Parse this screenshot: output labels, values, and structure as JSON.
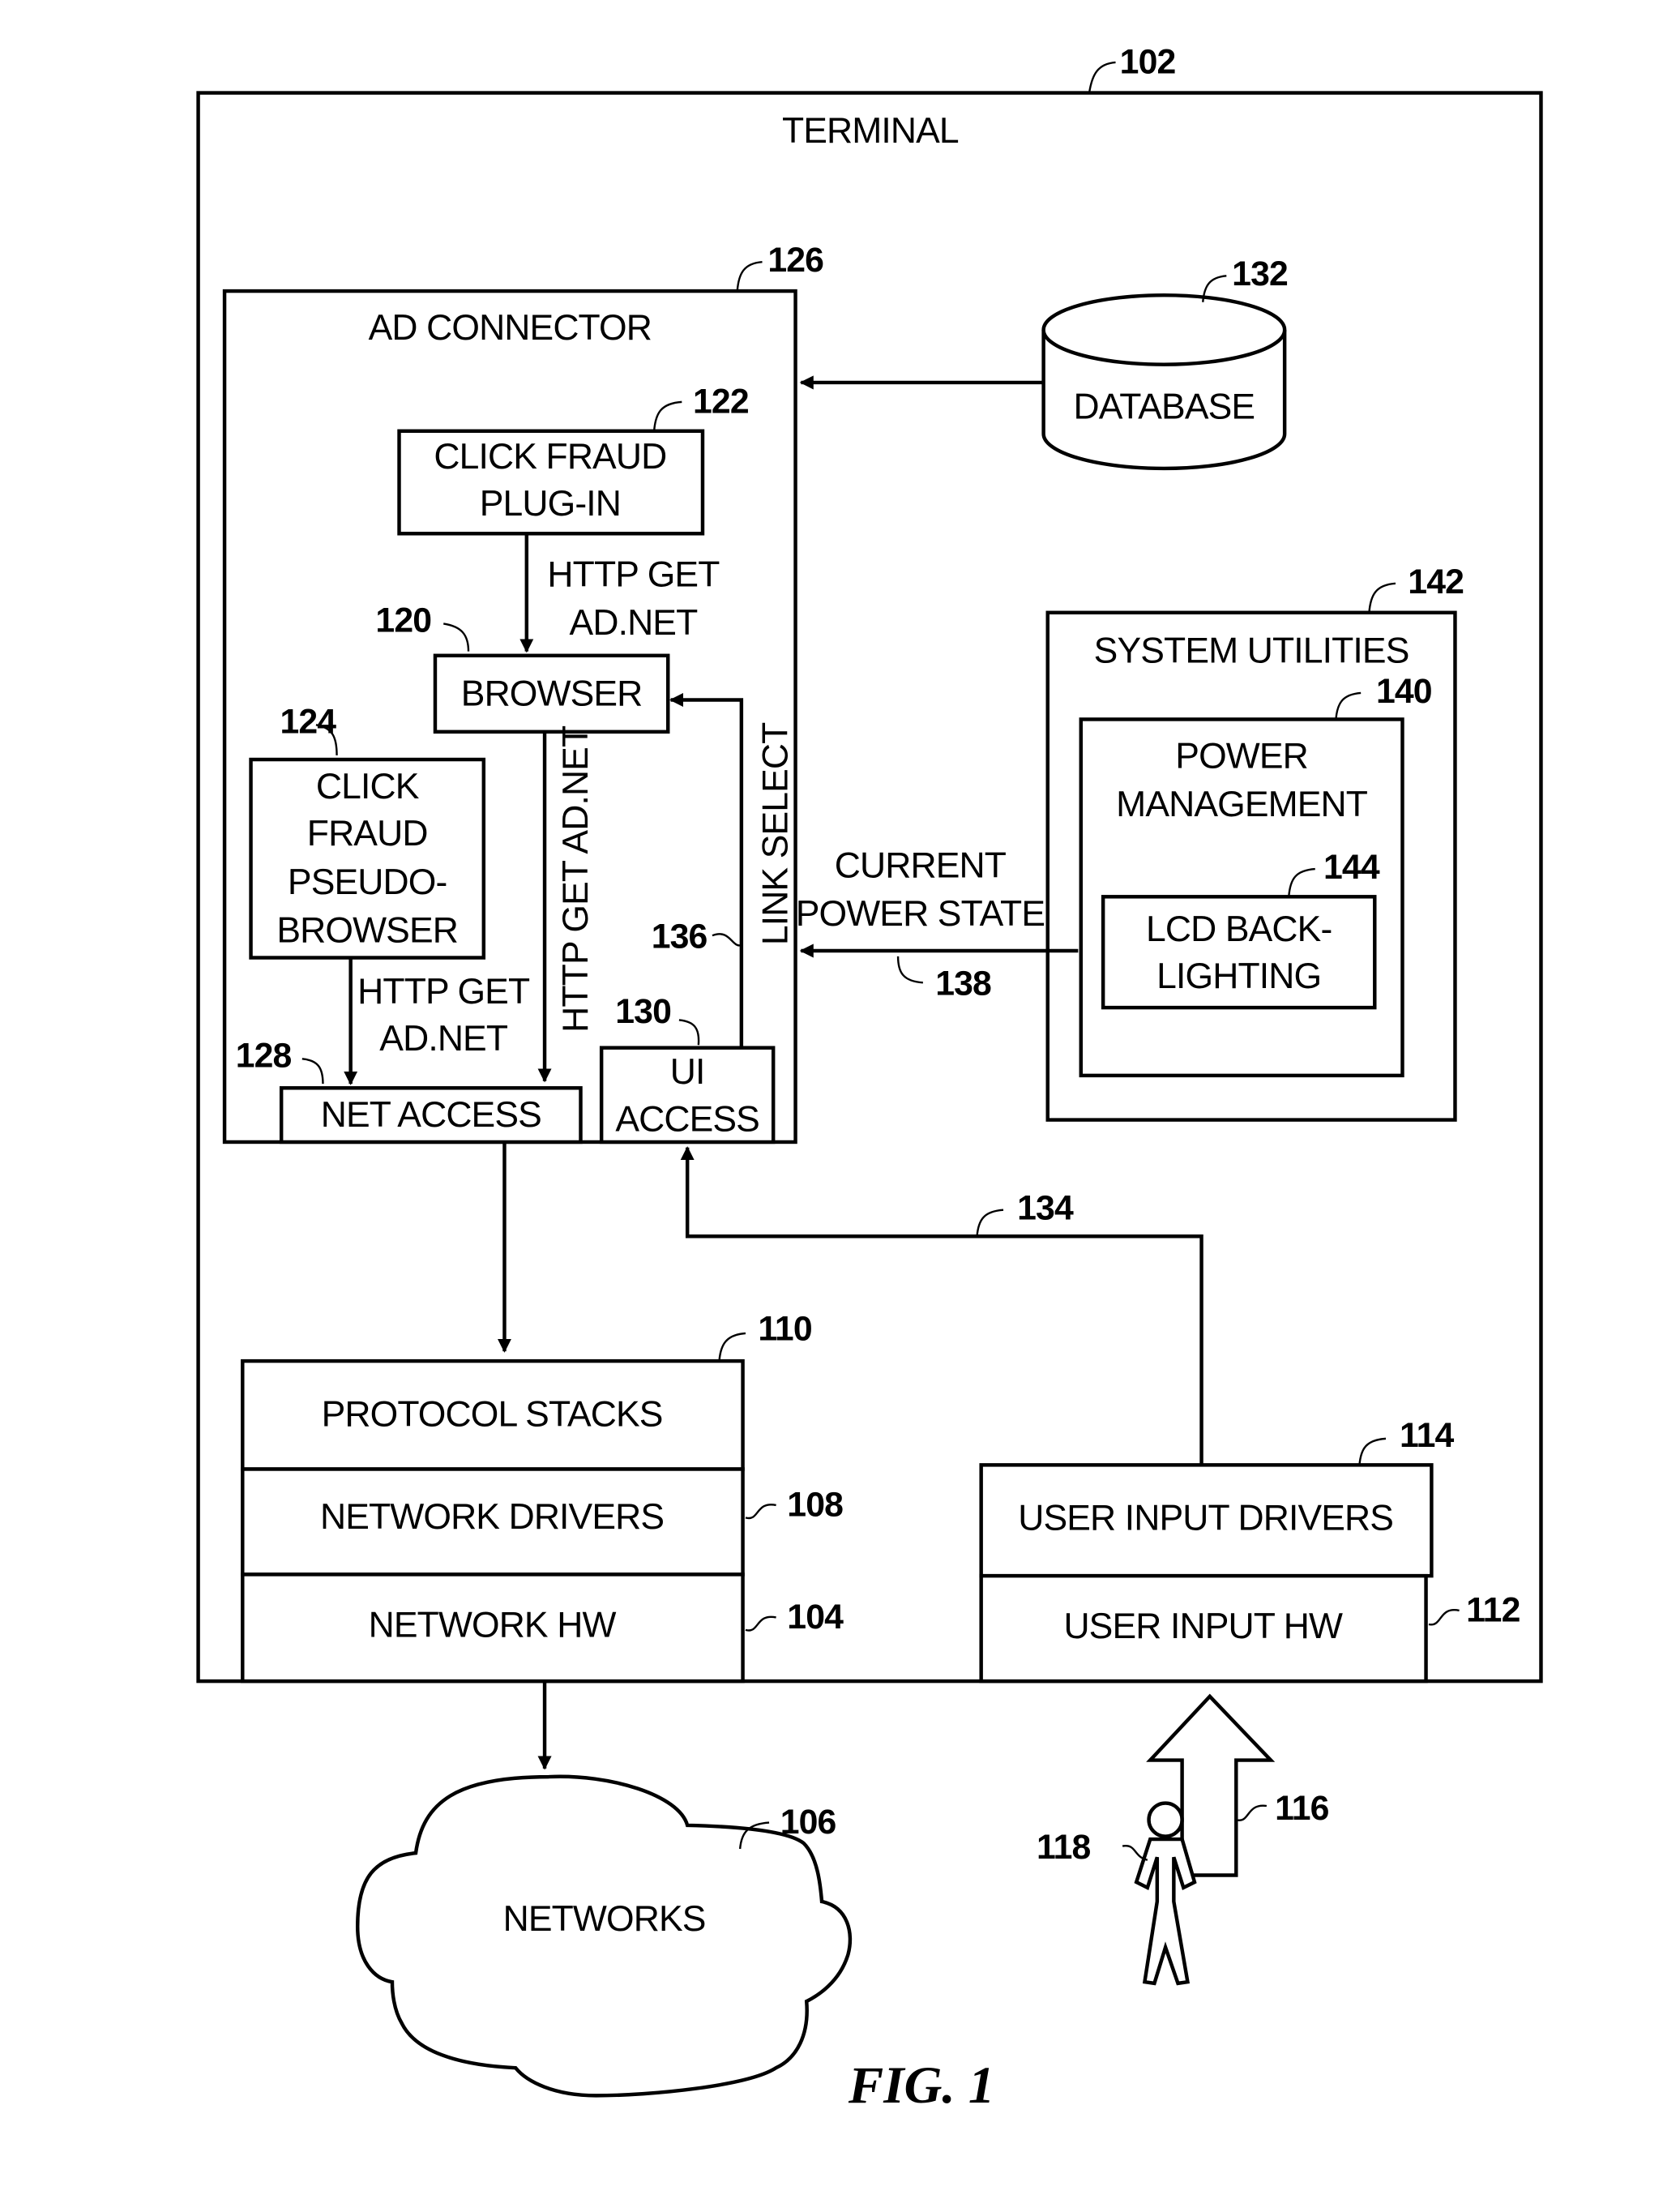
{
  "figure_label": "FIG. 1",
  "terminal": {
    "label": "TERMINAL",
    "ref": "102"
  },
  "ad_connector": {
    "label": "AD CONNECTOR",
    "ref": "126"
  },
  "click_fraud_plugin": {
    "lines": [
      "CLICK FRAUD",
      "PLUG-IN"
    ],
    "ref": "122"
  },
  "browser": {
    "label": "BROWSER",
    "ref": "120"
  },
  "pseudo_browser": {
    "lines": [
      "CLICK",
      "FRAUD",
      "PSEUDO-",
      "BROWSER"
    ],
    "ref": "124"
  },
  "net_access": {
    "label": "NET ACCESS",
    "ref": "128"
  },
  "ui_access": {
    "lines": [
      "UI",
      "ACCESS"
    ],
    "ref": "130"
  },
  "database": {
    "label": "DATABASE",
    "ref": "132"
  },
  "system_utilities": {
    "label": "SYSTEM UTILITIES",
    "ref": "142"
  },
  "power_management": {
    "lines": [
      "POWER",
      "MANAGEMENT"
    ],
    "ref": "140"
  },
  "lcd_backlighting": {
    "lines": [
      "LCD BACK-",
      "LIGHTING"
    ],
    "ref": "144"
  },
  "network_stack": {
    "protocol_stacks": {
      "label": "PROTOCOL STACKS",
      "ref": "110"
    },
    "network_drivers": {
      "label": "NETWORK  DRIVERS",
      "ref": "108"
    },
    "network_hw": {
      "label": "NETWORK  HW",
      "ref": "104"
    }
  },
  "user_input": {
    "drivers": {
      "label": "USER INPUT DRIVERS",
      "ref": "114"
    },
    "hw": {
      "label": "USER INPUT HW",
      "ref": "112"
    }
  },
  "networks": {
    "label": "NETWORKS",
    "ref": "106"
  },
  "user": {
    "ref": "118"
  },
  "user_input_arrow": {
    "ref": "116"
  },
  "arrows": {
    "plugin_to_browser": [
      "HTTP GET",
      "AD.NET"
    ],
    "pseudo_to_net": [
      "HTTP GET",
      "AD.NET"
    ],
    "browser_to_net": "HTTP GET AD.NET",
    "link_select": "LINK SELECT",
    "link_select_ref": "136",
    "power_state": [
      "CURRENT",
      "POWER STATE"
    ],
    "power_state_ref": "138",
    "ui_input_ref": "134"
  }
}
